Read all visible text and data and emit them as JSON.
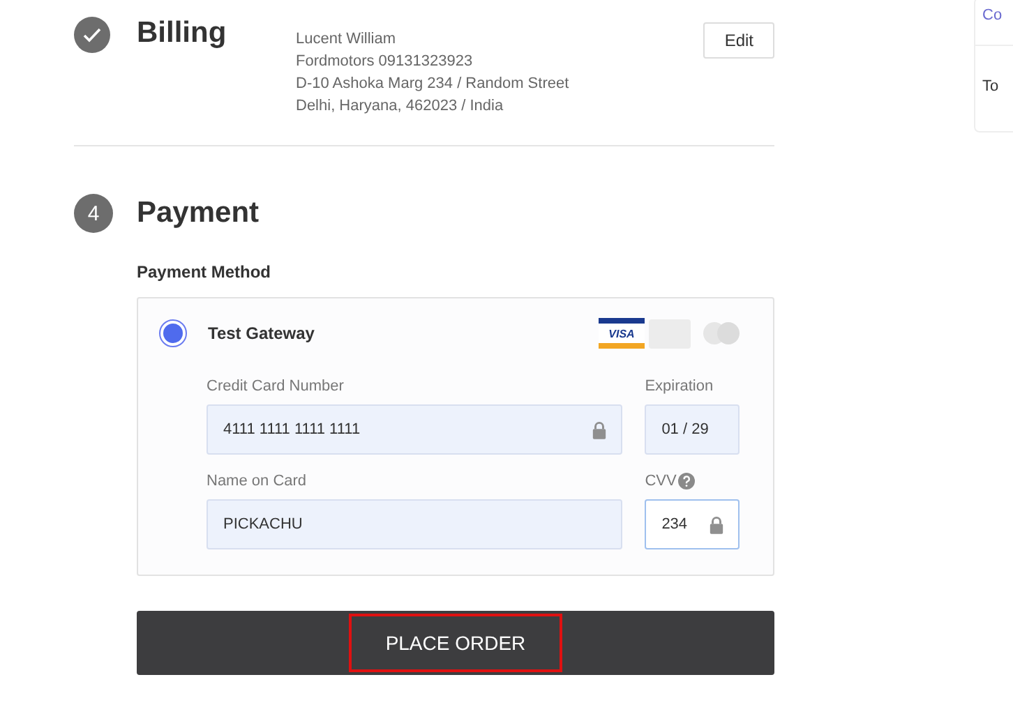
{
  "sections": [
    {
      "title": "Billing",
      "completed": true,
      "address": [
        "Lucent William",
        "Fordmotors 09131323923",
        "D-10 Ashoka Marg 234 / Random Street",
        "Delhi, Haryana, 462023 / India"
      ],
      "action": "Edit"
    },
    {
      "title": "Payment",
      "completed": false,
      "number": "4"
    }
  ],
  "payment": {
    "method_label": "Payment Method",
    "gateway": {
      "name": "Test Gateway",
      "selected": true,
      "brand": "VISA"
    },
    "rows": [
      {
        "fields": [
          {
            "label": "Credit Card Number",
            "value": "4111 1111 1111 1111",
            "locked": true,
            "focused": false
          },
          {
            "label": "Expiration",
            "value": "01 / 29",
            "locked": false,
            "focused": false
          }
        ]
      },
      {
        "fields": [
          {
            "label": "Name on Card",
            "value": "PICKACHU",
            "locked": false,
            "focused": false
          },
          {
            "label": "CVV",
            "value": "234",
            "locked": true,
            "focused": true,
            "help": true
          }
        ]
      }
    ]
  },
  "place_order": {
    "label": "PLACE ORDER",
    "highlighted": true
  },
  "side_panel": [
    "Co",
    "To"
  ]
}
